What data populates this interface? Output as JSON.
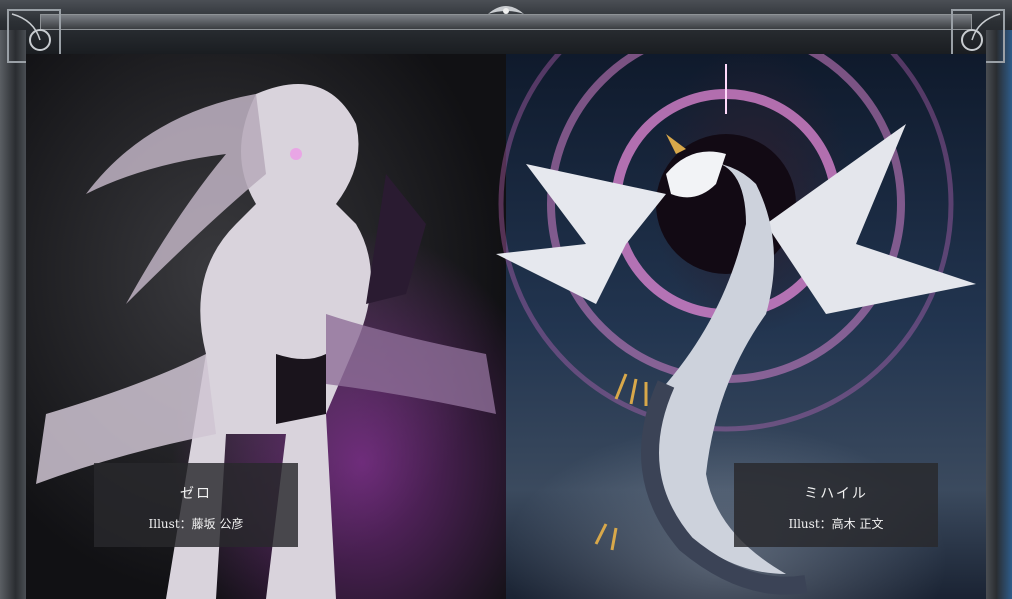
{
  "characters": [
    {
      "name": "ゼロ",
      "illust": "Illust：藤坂 公彦",
      "image_icon": "zero-character-art"
    },
    {
      "name": "ミハイル",
      "illust": "Illust：高木 正文",
      "image_icon": "mikhail-dragon-art"
    }
  ],
  "colors": {
    "frame": "#2c3035",
    "glow_pink": "#e58ad8",
    "caption_bg": "#28282c"
  }
}
